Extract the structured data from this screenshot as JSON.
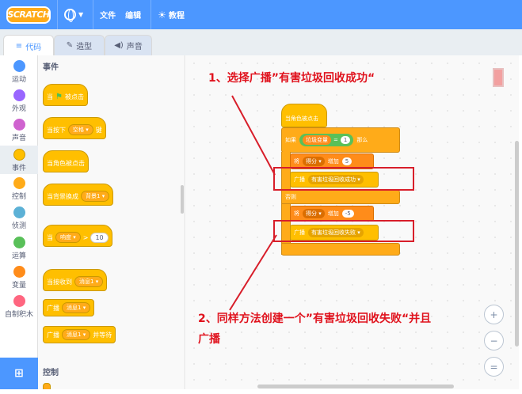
{
  "menu": {
    "logo": "SCRATCH",
    "file": "文件",
    "edit": "编辑",
    "tutorials": "教程"
  },
  "tabs": [
    {
      "label": "代码",
      "icon": "code-icon"
    },
    {
      "label": "造型",
      "icon": "brush-icon"
    },
    {
      "label": "声音",
      "icon": "speaker-icon"
    }
  ],
  "categories": [
    {
      "label": "运动",
      "color": "#4c97ff"
    },
    {
      "label": "外观",
      "color": "#9966ff"
    },
    {
      "label": "声音",
      "color": "#cf63cf"
    },
    {
      "label": "事件",
      "color": "#ffbf00"
    },
    {
      "label": "控制",
      "color": "#ffab19"
    },
    {
      "label": "侦测",
      "color": "#5cb1d6"
    },
    {
      "label": "运算",
      "color": "#59c059"
    },
    {
      "label": "变量",
      "color": "#ff8c1a"
    },
    {
      "label": "自制积木",
      "color": "#ff6680"
    }
  ],
  "palette": {
    "events_heading": "事件",
    "control_heading": "控制",
    "blocks": {
      "flag_clicked_pre": "当",
      "flag_clicked_post": "被点击",
      "key_pressed_pre": "当按下",
      "key_pressed_key": "空格",
      "key_pressed_post": "键",
      "sprite_clicked": "当角色被点击",
      "backdrop_pre": "当背景换成",
      "backdrop_val": "背景1",
      "greater_pre": "当",
      "greater_val": "响度",
      "greater_op": ">",
      "greater_num": "10",
      "receive_pre": "当接收到",
      "receive_val": "消息1",
      "broadcast_pre": "广播",
      "broadcast_val": "消息1",
      "broadcast_wait_pre": "广播",
      "broadcast_wait_val": "消息1",
      "broadcast_wait_post": "并等待"
    }
  },
  "script": {
    "hat": "当角色被点击",
    "if_label": "如果",
    "var_name": "垃圾变量",
    "eq": "=",
    "cond_value": "1",
    "then_label": "那么",
    "set1_pre": "将",
    "set1_var": "得分",
    "set1_op": "增加",
    "set1_val": "5",
    "bcast1_pre": "广播",
    "bcast1_msg": "有害垃圾回收成功",
    "else_label": "否则",
    "set2_pre": "将",
    "set2_var": "得分",
    "set2_op": "增加",
    "set2_val": "-5",
    "bcast2_pre": "广播",
    "bcast2_msg": "有害垃圾回收失败"
  },
  "annotations": {
    "step1": "1、选择广播”有害垃圾回收成功“",
    "step2_line1": "2、同样方法创建一个”有害垃圾回收失败“并且",
    "step2_line2": "广播"
  },
  "zoom": {
    "zoom_in": "+",
    "zoom_out": "−",
    "reset": "="
  },
  "colors": {
    "menubar": "#4c97ff",
    "events": "#ffbf00",
    "control": "#ffab19",
    "annotation": "#e0121d"
  }
}
